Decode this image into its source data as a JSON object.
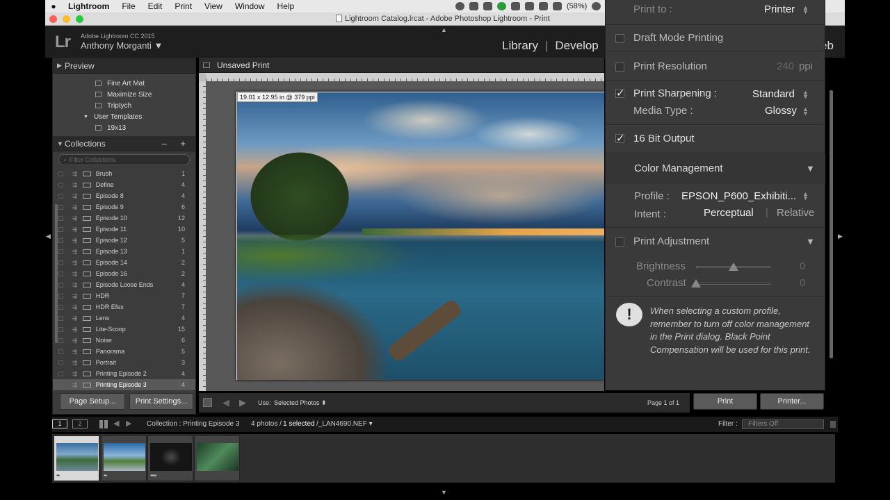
{
  "menubar": {
    "items": [
      "Lightroom",
      "File",
      "Edit",
      "Print",
      "View",
      "Window",
      "Help"
    ],
    "battery": "(58%)"
  },
  "window": {
    "title": "Lightroom Catalog.lrcat - Adobe Photoshop Lightroom - Print"
  },
  "identity": {
    "logo": "Lr",
    "version": "Adobe Lightroom CC 2015",
    "user": "Anthony Morganti ▼"
  },
  "modules": {
    "library": "Library",
    "develop": "Develop",
    "web_partial": "eb",
    "sep": "|"
  },
  "left": {
    "preview_label": "Preview",
    "templates": [
      "Fine Art Mat",
      "Maximize Size",
      "Triptych"
    ],
    "user_templates_label": "User Templates",
    "user_template": "19x13",
    "collections_label": "Collections",
    "collections_actions": "– +",
    "filter_placeholder": "Filter Collections",
    "collections": [
      {
        "name": "Brush",
        "count": "1"
      },
      {
        "name": "Define",
        "count": "4"
      },
      {
        "name": "Episode 8",
        "count": "4"
      },
      {
        "name": "Episode 9",
        "count": "6"
      },
      {
        "name": "Episode 10",
        "count": "12"
      },
      {
        "name": "Episode 11",
        "count": "10"
      },
      {
        "name": "Episode 12",
        "count": "5"
      },
      {
        "name": "Episode 13",
        "count": "1"
      },
      {
        "name": "Episode 14",
        "count": "2"
      },
      {
        "name": "Episode 16",
        "count": "2"
      },
      {
        "name": "Episode Loose Ends",
        "count": "4"
      },
      {
        "name": "HDR",
        "count": "7"
      },
      {
        "name": "HDR Efex",
        "count": "7"
      },
      {
        "name": "Lens",
        "count": "4"
      },
      {
        "name": "Lite-Scoop",
        "count": "15"
      },
      {
        "name": "Noise",
        "count": "6"
      },
      {
        "name": "Panorama",
        "count": "5"
      },
      {
        "name": "Portrait",
        "count": "3"
      },
      {
        "name": "Printing Episode 2",
        "count": "4"
      },
      {
        "name": "Printing Episode 3",
        "count": "4"
      }
    ],
    "page_setup": "Page Setup...",
    "print_settings": "Print Settings..."
  },
  "center": {
    "title": "Unsaved Print",
    "dimension_label": "19.01 x 12.95 in @ 379 ppi"
  },
  "toolbar": {
    "use_label": "Use:",
    "use_value": "Selected Photos ⬍",
    "page_of": "Page 1 of 1",
    "print": "Print",
    "printer": "Printer..."
  },
  "right": {
    "print_to_label": "Print to :",
    "print_to_value": "Printer",
    "draft_mode": "Draft Mode Printing",
    "print_resolution": "Print Resolution",
    "resolution_value": "240",
    "resolution_unit": "ppi",
    "sharpening_label": "Print Sharpening :",
    "sharpening_value": "Standard",
    "media_label": "Media Type :",
    "media_value": "Glossy",
    "bit_output": "16 Bit Output",
    "color_mgmt": "Color Management",
    "profile_label": "Profile :",
    "profile_value": "EPSON_P600_Exhibiti...",
    "intent_label": "Intent :",
    "intent_perceptual": "Perceptual",
    "intent_relative": "Relative",
    "print_adjustment": "Print Adjustment",
    "brightness_label": "Brightness",
    "brightness_value": "0",
    "contrast_label": "Contrast",
    "contrast_value": "0",
    "warning": "When selecting a custom profile, remember to turn off color management in the Print dialog. Black Point Compensation will be used for this print."
  },
  "filmhead": {
    "mon1": "1",
    "mon2": "2",
    "collection": "Collection : Printing Episode 3",
    "photos": "4 photos /",
    "selected": "1 selected",
    "file": "/_LAN4690.NEF ▾",
    "filter_label": "Filter :",
    "filter_value": "Filters Off"
  },
  "filmstrip": {
    "stars": [
      "**",
      "**",
      "****",
      ""
    ]
  }
}
